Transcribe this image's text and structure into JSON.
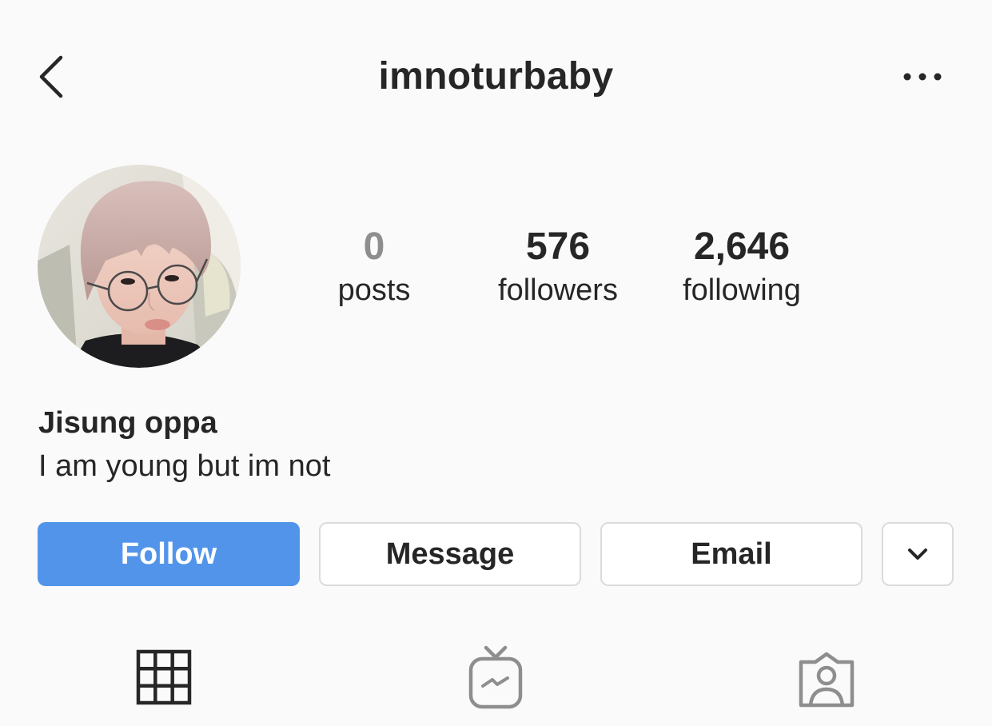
{
  "header": {
    "username": "imnoturbaby",
    "back_icon": "chevron-left-icon",
    "more_icon": "more-horizontal-icon"
  },
  "profile": {
    "avatar": "profile-photo",
    "full_name": "Jisung oppa",
    "bio": "I am young but im not"
  },
  "stats": {
    "posts": {
      "count": "0",
      "label": "posts"
    },
    "followers": {
      "count": "576",
      "label": "followers"
    },
    "following": {
      "count": "2,646",
      "label": "following"
    }
  },
  "actions": {
    "follow_label": "Follow",
    "message_label": "Message",
    "email_label": "Email",
    "dropdown_icon": "chevron-down-icon"
  },
  "tabs": [
    {
      "icon": "grid-icon",
      "active": true
    },
    {
      "icon": "igtv-icon",
      "active": false
    },
    {
      "icon": "tagged-icon",
      "active": false
    }
  ],
  "colors": {
    "follow_button": "#5294ea",
    "text": "#262626",
    "muted": "#8e8e8e",
    "background": "#fafafa",
    "border": "#dbdbdb"
  }
}
